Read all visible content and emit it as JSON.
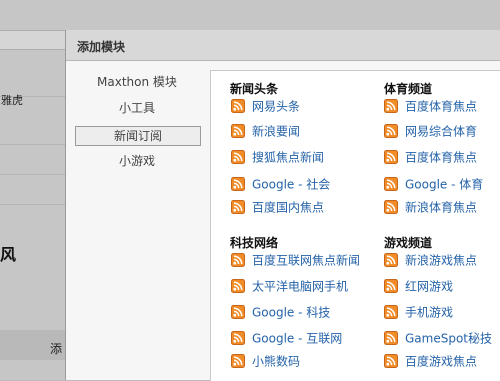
{
  "background": {
    "left_label": "雅虎",
    "big_char": "风",
    "bottom_label": "添"
  },
  "dialog": {
    "title": "添加模块"
  },
  "sidebar": {
    "items": [
      {
        "label": "Maxthon 模块"
      },
      {
        "label": "小工具"
      },
      {
        "label": "新闻订阅",
        "selected": true
      },
      {
        "label": "小游戏"
      }
    ]
  },
  "sections": [
    {
      "title": "新闻头条",
      "items": [
        "网易头条",
        "新浪要闻",
        "搜狐焦点新闻",
        "Google - 社会",
        "百度国内焦点"
      ]
    },
    {
      "title": "体育频道",
      "items": [
        "百度体育焦点",
        "网易综合体育",
        "百度体育焦点",
        "Google - 体育",
        "新浪体育焦点"
      ]
    },
    {
      "title": "科技网络",
      "items": [
        "百度互联网焦点新闻",
        "太平洋电脑网手机",
        "Google - 科技",
        "Google - 互联网",
        "小熊数码"
      ]
    },
    {
      "title": "游戏频道",
      "items": [
        "新浪游戏焦点",
        "红网游戏",
        "手机游戏",
        "GameSpot秘技",
        "百度游戏焦点"
      ]
    }
  ],
  "colors": {
    "rss_icon": "#f28c28",
    "link": "#2563a8",
    "header_bg": "#d8d8d8"
  },
  "icons": {
    "feed": "rss-icon"
  }
}
